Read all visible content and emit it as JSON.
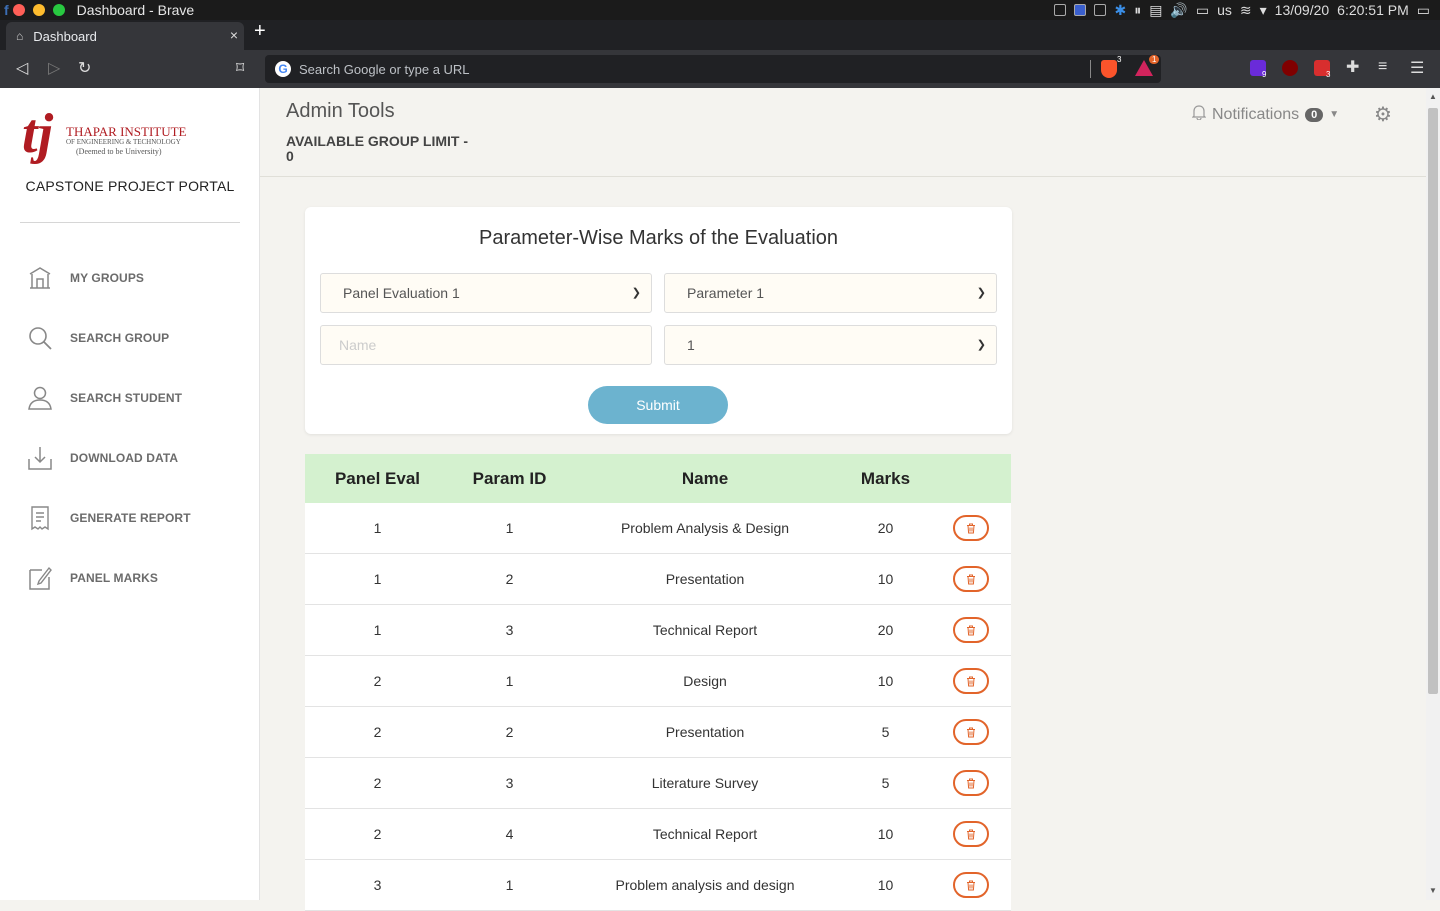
{
  "os": {
    "window_title": "Dashboard - Brave",
    "traffic_colors": [
      "#ff5f57",
      "#febc2e",
      "#28c840"
    ],
    "keyboard": "us",
    "date": "13/09/20",
    "time": "6:20:51 PM"
  },
  "browser": {
    "tab_title": "Dashboard",
    "tab_close": "×",
    "new_tab": "+",
    "omnibox_placeholder": "Search Google or type a URL",
    "brave_badge": "3",
    "rewards_badge": "1",
    "ext_badges": [
      "9",
      "3"
    ]
  },
  "sidebar": {
    "logo_letters": "tj",
    "logo_line1": "THAPAR INSTITUTE",
    "logo_line2": "OF ENGINEERING & TECHNOLOGY",
    "logo_line3": "(Deemed to be University)",
    "portal_title": "CAPSTONE PROJECT PORTAL",
    "items": [
      {
        "label": "MY GROUPS",
        "icon": "bank-icon"
      },
      {
        "label": "SEARCH GROUP",
        "icon": "search-icon"
      },
      {
        "label": "SEARCH STUDENT",
        "icon": "user-icon"
      },
      {
        "label": "DOWNLOAD DATA",
        "icon": "download-icon"
      },
      {
        "label": "GENERATE REPORT",
        "icon": "receipt-icon"
      },
      {
        "label": "PANEL MARKS",
        "icon": "edit-icon"
      }
    ]
  },
  "header": {
    "title": "Admin Tools",
    "group_limit": "AVAILABLE GROUP LIMIT - 0",
    "notifications_label": "Notifications",
    "notifications_count": "0"
  },
  "form": {
    "title": "Parameter-Wise Marks of the Evaluation",
    "panel_select": "Panel Evaluation 1",
    "parameter_select": "Parameter 1",
    "name_placeholder": "Name",
    "marks_select": "1",
    "submit_label": "Submit"
  },
  "table": {
    "headers": [
      "Panel Eval",
      "Param ID",
      "Name",
      "Marks"
    ],
    "rows": [
      {
        "panel": "1",
        "param": "1",
        "name": "Problem Analysis & Design",
        "marks": "20"
      },
      {
        "panel": "1",
        "param": "2",
        "name": "Presentation",
        "marks": "10"
      },
      {
        "panel": "1",
        "param": "3",
        "name": "Technical Report",
        "marks": "20"
      },
      {
        "panel": "2",
        "param": "1",
        "name": "Design",
        "marks": "10"
      },
      {
        "panel": "2",
        "param": "2",
        "name": "Presentation",
        "marks": "5"
      },
      {
        "panel": "2",
        "param": "3",
        "name": "Literature Survey",
        "marks": "5"
      },
      {
        "panel": "2",
        "param": "4",
        "name": "Technical Report",
        "marks": "10"
      },
      {
        "panel": "3",
        "param": "1",
        "name": "Problem analysis and design",
        "marks": "10"
      }
    ]
  },
  "colors": {
    "table_header_bg": "#d4f1cf",
    "delete_accent": "#e2642a",
    "submit_bg": "#6cb3cf",
    "brand_red": "#b01c22"
  }
}
